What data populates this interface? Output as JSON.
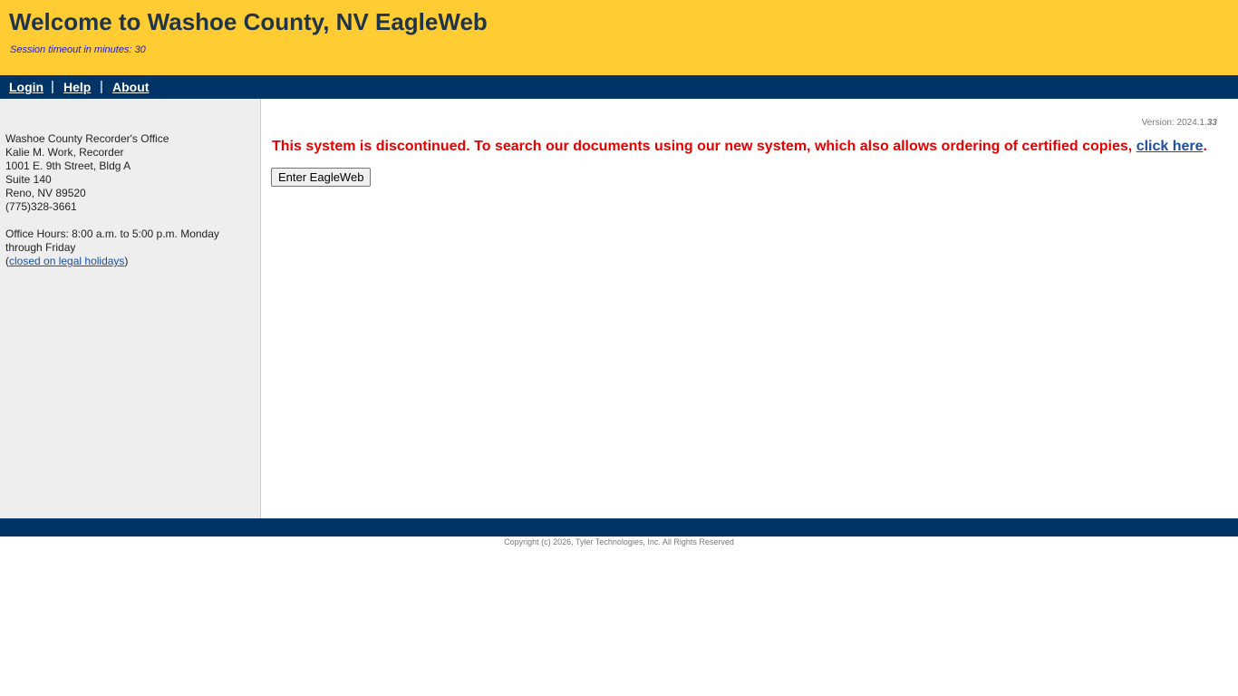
{
  "header": {
    "title": "Welcome to Washoe County, NV EagleWeb",
    "session_timeout": "Session timeout in minutes: 30"
  },
  "nav": {
    "login": "Login",
    "help": "Help",
    "about": "About",
    "separator": "|"
  },
  "sidebar": {
    "office": "Washoe County Recorder's Office",
    "recorder": "Kalie M. Work, Recorder",
    "address1": "1001 E. 9th Street, Bldg A",
    "address2": "Suite 140",
    "city": "Reno, NV 89520",
    "phone": "(775)328-3661",
    "hours": "Office Hours: 8:00 a.m. to 5:00 p.m. Monday through Friday",
    "holidays_open": "(",
    "holidays_link": "closed on legal holidays",
    "holidays_close": ")"
  },
  "main": {
    "version_prefix": "Version: 2024.1.",
    "version_suffix": "33",
    "notice": "This system is discontinued. To search our documents using our new system, which also allows ordering of certified copies, ",
    "notice_link": "click here",
    "notice_end": ".",
    "enter_button": "Enter EagleWeb"
  },
  "footer": {
    "copyright": "Copyright (c) 2026, Tyler Technologies, Inc. All Rights Reserved"
  },
  "colors": {
    "header_bg": "#ffcc33",
    "nav_bg": "#003366",
    "notice": "#e60000",
    "link": "#1a4fa0"
  }
}
